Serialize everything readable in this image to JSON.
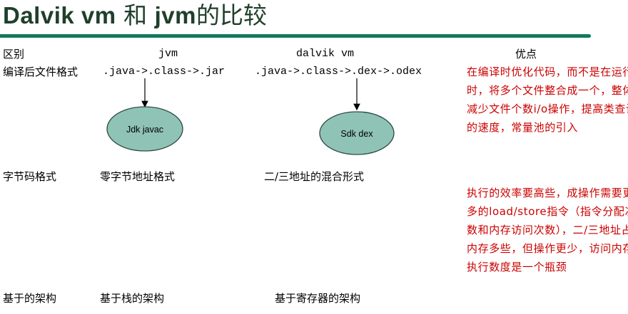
{
  "title": {
    "latin_part": "Dalvik vm",
    "conj": "和",
    "jvm": "jvm",
    "suffix": "的比较"
  },
  "header": {
    "diff": "区别",
    "jvm": "jvm",
    "dalvik": "dalvik vm",
    "advantages": "优点"
  },
  "rows": {
    "compiled_format": {
      "label": "编译后文件格式",
      "jvm_chain": ".java->.class->.jar",
      "dalvik_chain": ".java->.class->.dex->.odex",
      "jvm_tool": "Jdk javac",
      "dalvik_tool": "Sdk dex",
      "advantage": "在编译时优化代码，而不是在运行时，将多个文件整合成一个，整体减少文件个数i/o操作，提高类查询的速度，常量池的引入"
    },
    "bytecode_format": {
      "label": "字节码格式",
      "jvm": "零字节地址格式",
      "dalvik": "二/三地址的混合形式",
      "advantage": "执行的效率要高些，成操作需要更多的load/store指令（指令分配次数和内存访问次数），二/三地址占内存多些，但操作更少，访问内存执行数度是一个瓶颈"
    },
    "architecture": {
      "label": "基于的架构",
      "jvm": "基于栈的架构",
      "dalvik": "基于寄存器的架构"
    }
  },
  "colors": {
    "title": "#1f3f2a",
    "rule": "#0f7a5c",
    "oval_fill": "#8fc3b5",
    "advantage_text": "#cc0000"
  }
}
